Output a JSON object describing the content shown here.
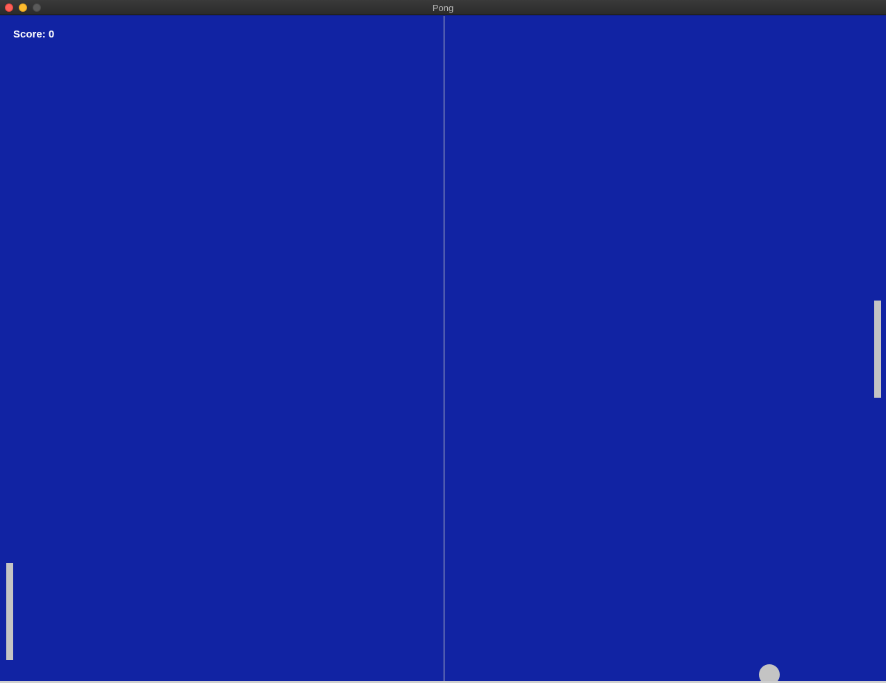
{
  "window": {
    "title": "Pong",
    "controls": [
      "close-button",
      "minimize-button",
      "zoom-button"
    ]
  },
  "game": {
    "score_label": "Score: 0",
    "background_color": "#1123a3",
    "paddle_color": "#c4c4c4",
    "ball_color": "#c4c4c4",
    "center_line_color": "#c8c8c8"
  }
}
